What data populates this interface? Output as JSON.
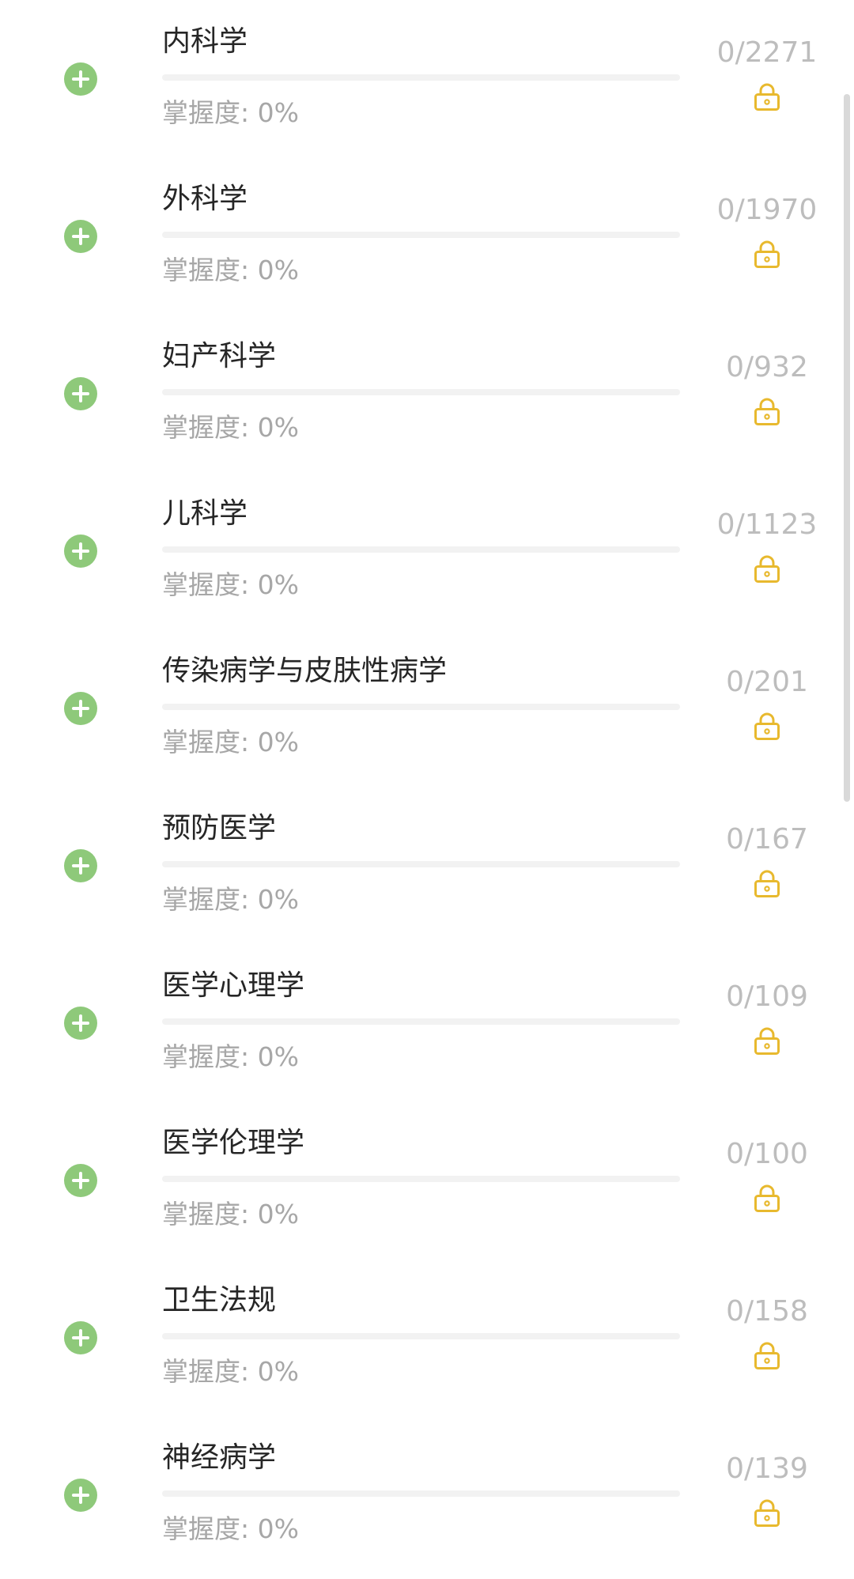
{
  "mastery_label": "掌握度:",
  "colors": {
    "accent_green": "#8ec97a",
    "lock_gold": "#e8b92e",
    "title_text": "#262626",
    "muted_text": "#a7a7a7",
    "count_text": "#bdbdbd"
  },
  "subjects": [
    {
      "title": "内科学",
      "mastery": "0%",
      "mastery_value": 0,
      "count": "0/2271",
      "icon": "lock-icon"
    },
    {
      "title": "外科学",
      "mastery": "0%",
      "mastery_value": 0,
      "count": "0/1970",
      "icon": "lock-icon"
    },
    {
      "title": "妇产科学",
      "mastery": "0%",
      "mastery_value": 0,
      "count": "0/932",
      "icon": "lock-icon"
    },
    {
      "title": "儿科学",
      "mastery": "0%",
      "mastery_value": 0,
      "count": "0/1123",
      "icon": "lock-icon"
    },
    {
      "title": "传染病学与皮肤性病学",
      "mastery": "0%",
      "mastery_value": 0,
      "count": "0/201",
      "icon": "lock-icon"
    },
    {
      "title": "预防医学",
      "mastery": "0%",
      "mastery_value": 0,
      "count": "0/167",
      "icon": "lock-icon"
    },
    {
      "title": "医学心理学",
      "mastery": "0%",
      "mastery_value": 0,
      "count": "0/109",
      "icon": "lock-icon"
    },
    {
      "title": "医学伦理学",
      "mastery": "0%",
      "mastery_value": 0,
      "count": "0/100",
      "icon": "lock-icon"
    },
    {
      "title": "卫生法规",
      "mastery": "0%",
      "mastery_value": 0,
      "count": "0/158",
      "icon": "lock-icon"
    },
    {
      "title": "神经病学",
      "mastery": "0%",
      "mastery_value": 0,
      "count": "0/139",
      "icon": "lock-icon"
    }
  ]
}
